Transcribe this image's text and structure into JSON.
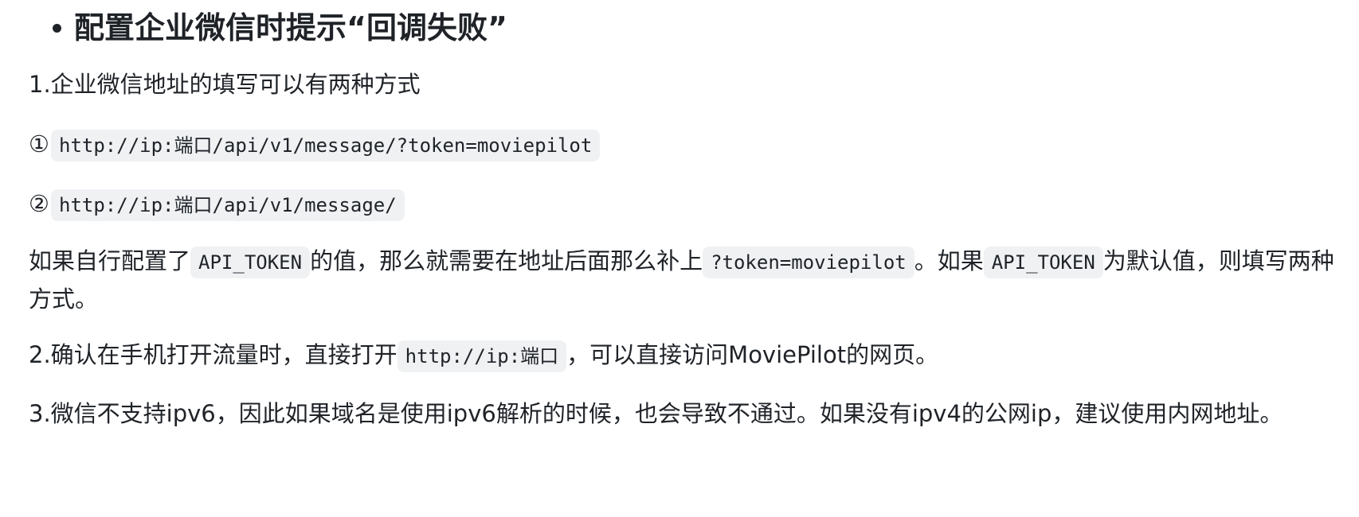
{
  "heading": "配置企业微信时提示“回调失败”",
  "p1": "1.企业微信地址的填写可以有两种方式",
  "opt1": {
    "marker": "①",
    "code": "http://ip:端口/api/v1/message/?token=moviepilot"
  },
  "opt2": {
    "marker": "②",
    "code": "http://ip:端口/api/v1/message/"
  },
  "p2": {
    "t1": "如果自行配置了",
    "c1": "API_TOKEN",
    "t2": "的值，那么就需要在地址后面那么补上",
    "c2": "?token=moviepilot",
    "t3": "。如果",
    "c3": "API_TOKEN",
    "t4": "为默认值，则填写两种方式。"
  },
  "p3": {
    "t1": "2.确认在手机打开流量时，直接打开",
    "c1": "http://ip:端口",
    "t2": "，可以直接访问MoviePilot的网页。"
  },
  "p4": "3.微信不支持ipv6，因此如果域名是使用ipv6解析的时候，也会导致不通过。如果没有ipv4的公网ip，建议使用内网地址。"
}
